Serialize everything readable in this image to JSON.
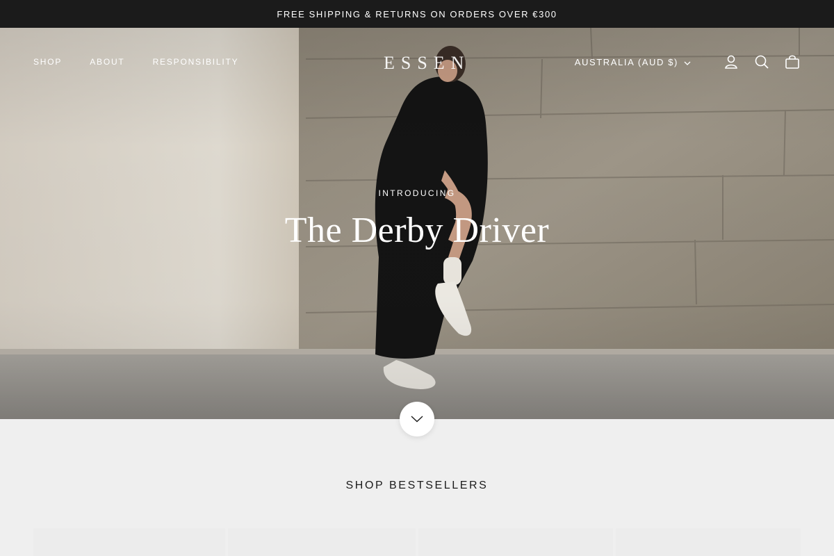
{
  "announcement": {
    "text": "FREE SHIPPING & RETURNS ON ORDERS OVER €300"
  },
  "header": {
    "nav": [
      {
        "label": "SHOP"
      },
      {
        "label": "ABOUT"
      },
      {
        "label": "RESPONSIBILITY"
      }
    ],
    "logo_text": "ESSEN",
    "locale": {
      "label": "AUSTRALIA (AUD $)",
      "icon": "chevron-down-icon"
    },
    "icons": [
      "account-icon",
      "search-icon",
      "cart-icon"
    ]
  },
  "hero": {
    "eyebrow": "INTRODUCING",
    "title": "The Derby Driver",
    "scroll_icon": "chevron-down-icon"
  },
  "bestsellers": {
    "title": "SHOP BESTSELLERS"
  },
  "colors": {
    "announcement_bg": "#1b1b1b",
    "page_bg": "#efefef",
    "text_dark": "#1b1b1b"
  }
}
